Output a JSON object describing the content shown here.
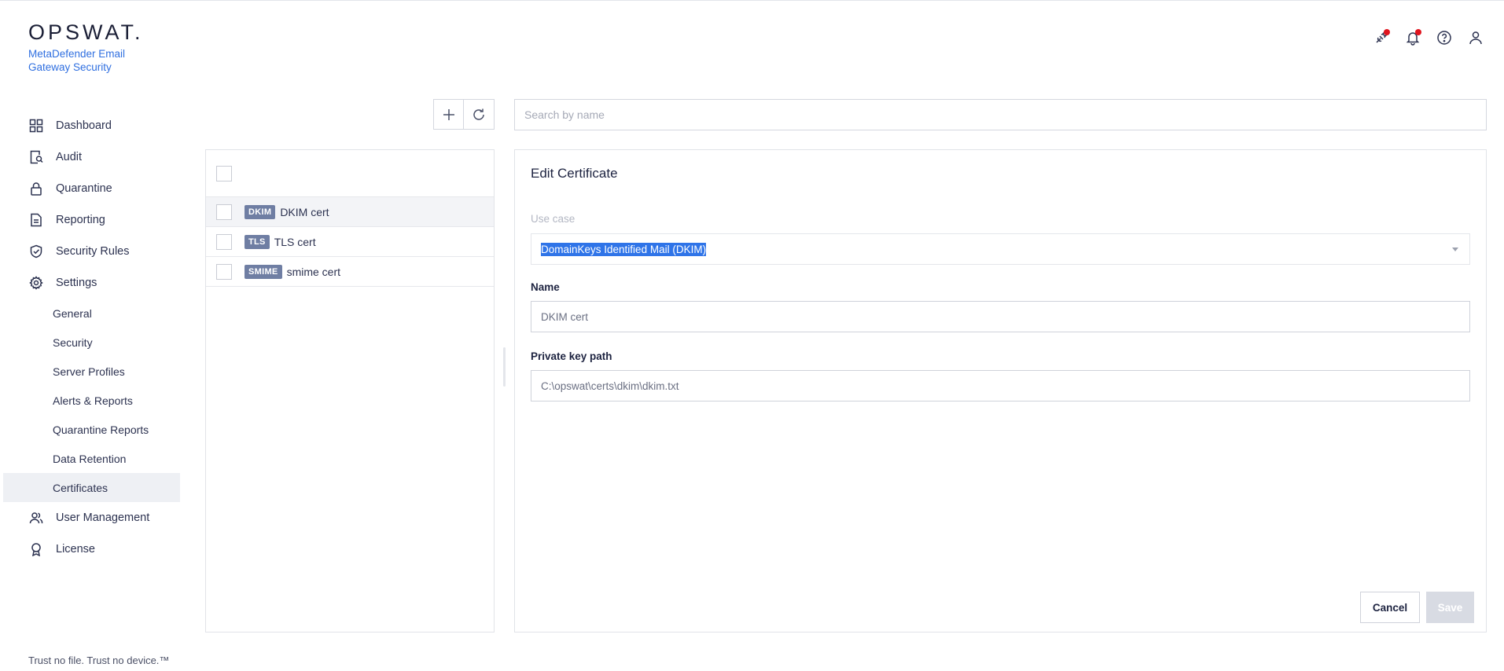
{
  "brand": {
    "logo": "OPSWAT.",
    "product": "MetaDefender Email Gateway Security"
  },
  "header_icons": [
    "connection-icon",
    "bell-icon",
    "help-icon",
    "user-icon"
  ],
  "sidebar": {
    "items": [
      {
        "label": "Dashboard",
        "icon": "dashboard-icon"
      },
      {
        "label": "Audit",
        "icon": "audit-icon"
      },
      {
        "label": "Quarantine",
        "icon": "lock-icon"
      },
      {
        "label": "Reporting",
        "icon": "document-icon"
      },
      {
        "label": "Security Rules",
        "icon": "shield-check-icon"
      },
      {
        "label": "Settings",
        "icon": "gear-icon"
      }
    ],
    "settings_sub": [
      {
        "label": "General"
      },
      {
        "label": "Security"
      },
      {
        "label": "Server Profiles"
      },
      {
        "label": "Alerts & Reports"
      },
      {
        "label": "Quarantine Reports"
      },
      {
        "label": "Data Retention"
      },
      {
        "label": "Certificates",
        "active": true
      }
    ],
    "bottom_items": [
      {
        "label": "User Management",
        "icon": "users-icon"
      },
      {
        "label": "License",
        "icon": "badge-icon"
      }
    ]
  },
  "footer": "Trust no file. Trust no device.™",
  "toolbar": {
    "add_icon": "plus-icon",
    "refresh_icon": "refresh-icon",
    "search_placeholder": "Search by name"
  },
  "certificates": [
    {
      "tag": "DKIM",
      "name": "DKIM cert",
      "selected": true
    },
    {
      "tag": "TLS",
      "name": "TLS cert"
    },
    {
      "tag": "SMIME",
      "name": "smime cert"
    }
  ],
  "edit": {
    "title": "Edit Certificate",
    "use_case_label": "Use case",
    "use_case_value": "DomainKeys Identified Mail (DKIM)",
    "name_label": "Name",
    "name_value": "DKIM cert",
    "key_label": "Private key path",
    "key_value": "C:\\opswat\\certs\\dkim\\dkim.txt",
    "cancel_label": "Cancel",
    "save_label": "Save"
  },
  "colors": {
    "accent": "#2f6fe0",
    "tag": "#6f7ea3",
    "notification_dot": "#e0141e",
    "selection": "#2f74e8"
  }
}
